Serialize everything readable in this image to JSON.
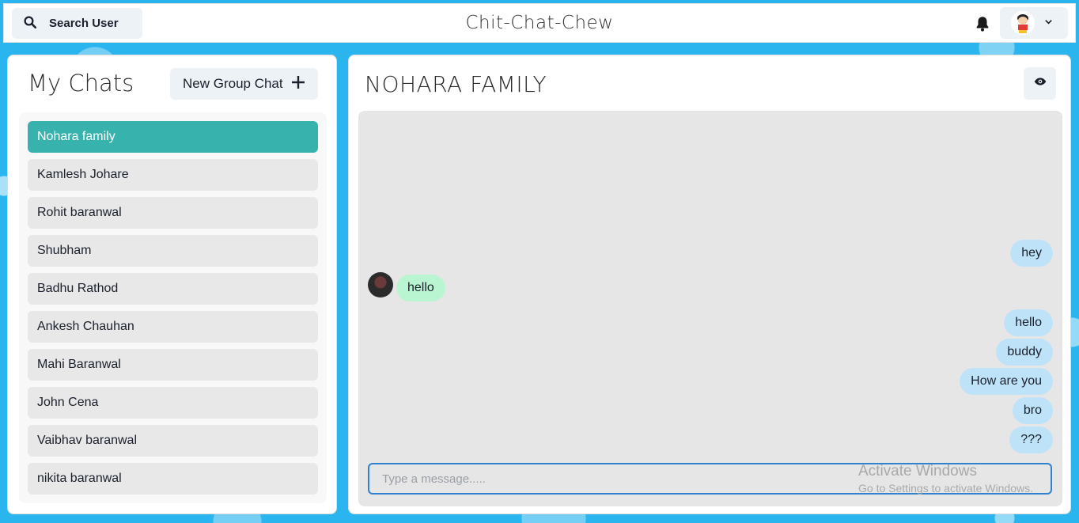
{
  "header": {
    "search_label": "Search User",
    "app_title": "Chit-Chat-Chew",
    "icons": {
      "search": "search-icon",
      "bell": "bell-icon",
      "chevron": "chevron-down-icon"
    }
  },
  "chats": {
    "heading": "My Chats",
    "new_group_label": "New Group Chat",
    "items": [
      {
        "label": "Nohara family",
        "active": true
      },
      {
        "label": "Kamlesh Johare"
      },
      {
        "label": "Rohit baranwal"
      },
      {
        "label": "Shubham"
      },
      {
        "label": "Badhu Rathod"
      },
      {
        "label": "Ankesh Chauhan"
      },
      {
        "label": "Mahi Baranwal"
      },
      {
        "label": "John Cena"
      },
      {
        "label": "Vaibhav baranwal"
      },
      {
        "label": "nikita baranwal"
      }
    ]
  },
  "conversation": {
    "title": "NOHARA FAMILY",
    "messages": [
      {
        "text": "hey",
        "from": "me"
      },
      {
        "text": "hello",
        "from": "them"
      },
      {
        "text": "hello",
        "from": "me"
      },
      {
        "text": "buddy",
        "from": "me"
      },
      {
        "text": "How are you",
        "from": "me"
      },
      {
        "text": "bro",
        "from": "me"
      },
      {
        "text": "???",
        "from": "me"
      }
    ],
    "input_placeholder": "Type a message....."
  },
  "watermark": {
    "line1": "Activate Windows",
    "line2": "Go to Settings to activate Windows."
  },
  "colors": {
    "accent": "#38b2ac",
    "my_bubble": "#bee3f8",
    "their_bubble": "#b9f5d0",
    "background": "#2bb5ee"
  }
}
